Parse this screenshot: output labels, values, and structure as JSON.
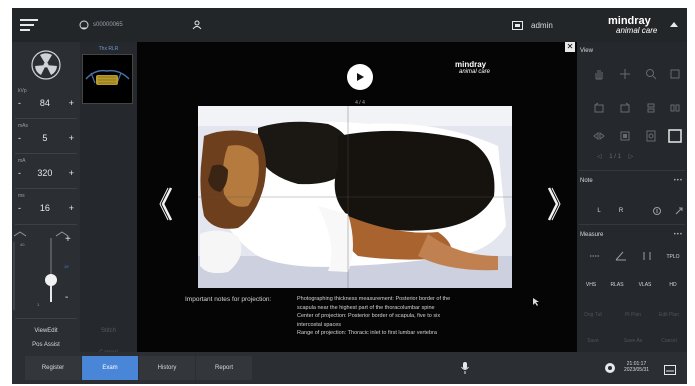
{
  "topbar": {
    "patient_id": "s00000065",
    "user": "admin",
    "brand_main": "mindray",
    "brand_sub": "animal care"
  },
  "left": {
    "params": [
      {
        "label": "kVp",
        "value": "84",
        "minus": "-",
        "plus": "+"
      },
      {
        "label": "mAs",
        "value": "5",
        "minus": "-",
        "plus": "+"
      },
      {
        "label": "mA",
        "value": "320",
        "minus": "-",
        "plus": "+"
      },
      {
        "label": "ms",
        "value": "16",
        "minus": "-",
        "plus": "+"
      }
    ],
    "slider": {
      "top_value": "40",
      "side_value": "19",
      "bottom_value": "1",
      "level": 0.35
    },
    "buttons": {
      "view_edit": "ViewEdit",
      "pos_assist": "Pos Assist"
    }
  },
  "thumbs": {
    "title": "Thx RLR",
    "btn1": "Stitch",
    "btn2": "Cancel"
  },
  "viewer": {
    "counter": "4 / 4",
    "logo_main": "mindray",
    "logo_sub": "animal care",
    "notes_label": "Important notes for projection:",
    "notes": [
      "Photographing thickness measurement: Posterior border of the",
      "scapula near the highest part of the thoracolumbar spine",
      "Center of projection: Posterior border of scapula, five to six",
      "intercostal spaces",
      "Range of projection: Thoracic inlet to first lumbar vertebra"
    ]
  },
  "right": {
    "view_title": "View",
    "pager": "1 / 1",
    "note_title": "Note",
    "note_l": "L",
    "note_r": "R",
    "measure_title": "Measure",
    "measure_tplo": "TPLO",
    "measure_row2": [
      "VHS",
      "RLAS",
      "VLAS",
      "HD"
    ],
    "measure_row3": [
      "Dog Tuf",
      "Pt Plan",
      "Edit Plan"
    ],
    "measure_row4": [
      "Save",
      "Save As",
      "Cancel"
    ],
    "more": "•••"
  },
  "bottom": {
    "tabs": [
      "Register",
      "Exam",
      "History",
      "Report"
    ],
    "active_tab": "Exam",
    "time": "21:01:17",
    "date": "2023/05/31"
  },
  "colors": {
    "accent": "#4a86d8",
    "panel": "#2b2e33",
    "viewer_bg": "#050505"
  }
}
